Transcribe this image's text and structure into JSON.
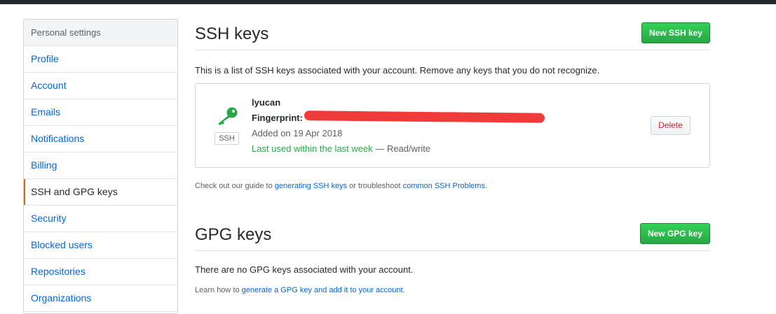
{
  "sidebar": {
    "header": "Personal settings",
    "items": [
      {
        "label": "Profile"
      },
      {
        "label": "Account"
      },
      {
        "label": "Emails"
      },
      {
        "label": "Notifications"
      },
      {
        "label": "Billing"
      },
      {
        "label": "SSH and GPG keys",
        "selected": true
      },
      {
        "label": "Security"
      },
      {
        "label": "Blocked users"
      },
      {
        "label": "Repositories"
      },
      {
        "label": "Organizations"
      }
    ]
  },
  "ssh": {
    "title": "SSH keys",
    "new_button": "New SSH key",
    "intro": "This is a list of SSH keys associated with your account. Remove any keys that you do not recognize.",
    "key": {
      "title": "lyucan",
      "fingerprint_label": "Fingerprint:",
      "type_label": "SSH",
      "added": "Added on 19 Apr 2018",
      "last_used": "Last used within the last week",
      "access": " — Read/write",
      "delete_button": "Delete",
      "icon": "key-icon",
      "icon_color": "#28a745"
    },
    "guide": {
      "prefix": "Check out our guide to ",
      "link1": "generating SSH keys",
      "middle": " or troubleshoot ",
      "link2": "common SSH Problems",
      "suffix": "."
    }
  },
  "gpg": {
    "title": "GPG keys",
    "new_button": "New GPG key",
    "empty": "There are no GPG keys associated with your account.",
    "learn": {
      "prefix": "Learn how to ",
      "link": "generate a GPG key and add it to your account",
      "suffix": "."
    }
  },
  "colors": {
    "accent": "#0366d6",
    "selected_marker": "#e36209",
    "primary_button": "#28a745",
    "danger": "#cb2431"
  }
}
